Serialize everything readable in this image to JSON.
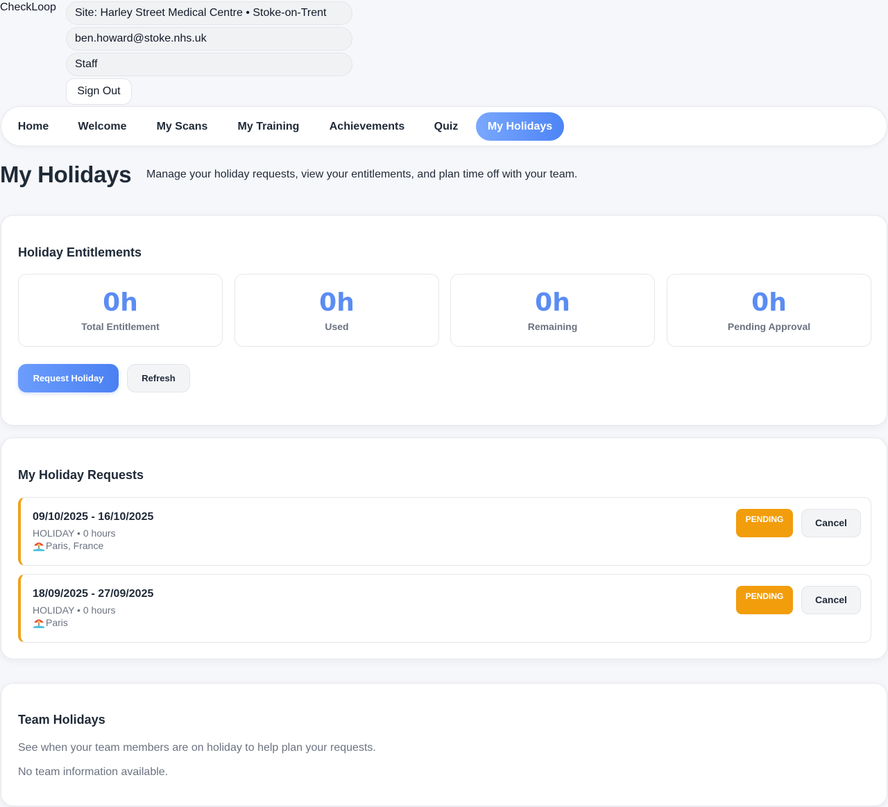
{
  "header": {
    "brand": "CheckLoop",
    "site": "Site: Harley Street Medical Centre • Stoke-on-Trent",
    "email": "ben.howard@stoke.nhs.uk",
    "role": "Staff",
    "sign_out": "Sign Out"
  },
  "nav": {
    "items": [
      {
        "label": "Home"
      },
      {
        "label": "Welcome"
      },
      {
        "label": "My Scans"
      },
      {
        "label": "My Training"
      },
      {
        "label": "Achievements"
      },
      {
        "label": "Quiz"
      },
      {
        "label": "My Holidays",
        "active": true
      }
    ],
    "active_color": "#5b8cf3"
  },
  "page": {
    "title": "My Holidays",
    "subtitle": "Manage your holiday requests, view your entitlements, and plan time off with your team."
  },
  "entitlements": {
    "title": "Holiday Entitlements",
    "stats": [
      {
        "value": "0h",
        "label": "Total Entitlement"
      },
      {
        "value": "0h",
        "label": "Used"
      },
      {
        "value": "0h",
        "label": "Remaining"
      },
      {
        "value": "0h",
        "label": "Pending Approval"
      }
    ],
    "request_button": "Request Holiday",
    "refresh_button": "Refresh"
  },
  "requests": {
    "title": "My Holiday Requests",
    "items": [
      {
        "dates": "09/10/2025 - 16/10/2025",
        "meta": "HOLIDAY • 0 hours",
        "icon": "beach-umbrella-icon",
        "location": "Paris, France",
        "status": "PENDING",
        "action": "Cancel"
      },
      {
        "dates": "18/09/2025 - 27/09/2025",
        "meta": "HOLIDAY • 0 hours",
        "icon": "beach-umbrella-icon",
        "location": "Paris",
        "status": "PENDING",
        "action": "Cancel"
      }
    ],
    "pending_color": "#f29d0c"
  },
  "team": {
    "title": "Team Holidays",
    "description": "See when your team members are on holiday to help plan your requests.",
    "empty": "No team information available."
  }
}
